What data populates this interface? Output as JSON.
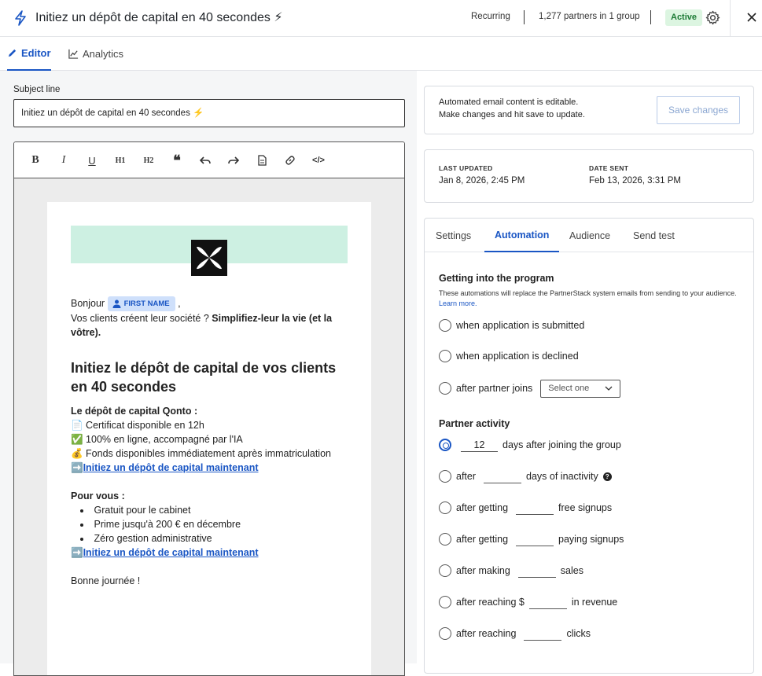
{
  "header": {
    "title": "Initiez un dépôt de capital en 40 secondes ⚡",
    "schedule": "Recurring",
    "audience_summary": "1,277 partners in 1 group",
    "status": "Active",
    "accent": "#1a56c4"
  },
  "tabs": [
    {
      "label": "Editor",
      "icon": "pencil-icon",
      "active": true
    },
    {
      "label": "Analytics",
      "icon": "chart-line-icon",
      "active": false
    }
  ],
  "subject": {
    "label": "Subject line",
    "value": "Initiez un dépôt de capital en 40 secondes ⚡"
  },
  "toolbar": {
    "buttons": [
      "bold-icon",
      "italic-icon",
      "underline-icon",
      "h1-icon",
      "h2-icon",
      "quote-icon",
      "undo-icon",
      "redo-icon",
      "document-icon",
      "link-icon",
      "code-icon"
    ],
    "h1": "H1",
    "h2": "H2"
  },
  "email": {
    "greeting": "Bonjour",
    "merge_tag": "FIRST NAME",
    "greeting_suffix": ",",
    "intro": "Vos clients créent leur société ?",
    "intro_bold": "Simplifiez-leur la vie (et la vôtre).",
    "heading": "Initiez le dépôt de capital de vos clients en 40 secondes",
    "section1_title": "Le dépôt de capital Qonto :",
    "section1_lines": [
      "📄 Certificat disponible en 12h",
      "✅ 100% en ligne, accompagné par l'IA",
      "💰 Fonds disponibles immédiatement après immatriculation"
    ],
    "cta_prefix": "➡️",
    "cta": "Initiez un dépôt de capital maintenant",
    "section2_title": "Pour vous :",
    "section2_items": [
      "Gratuit pour le cabinet",
      "Prime jusqu'à 200 € en décembre",
      "Zéro gestion administrative"
    ],
    "closing": "Bonne journée !"
  },
  "notice": {
    "line1": "Automated email content is editable.",
    "line2": "Make changes and hit save to update.",
    "save_label": "Save changes"
  },
  "dates": {
    "last_updated_label": "LAST UPDATED",
    "last_updated": "Jan 8, 2026, 2:45 PM",
    "date_sent_label": "DATE SENT",
    "date_sent": "Feb 13, 2026, 3:31 PM"
  },
  "panel_tabs": [
    {
      "label": "Settings",
      "active": false
    },
    {
      "label": "Automation",
      "active": true
    },
    {
      "label": "Audience",
      "active": false
    },
    {
      "label": "Send test",
      "active": false
    }
  ],
  "automation": {
    "program_title": "Getting into the program",
    "program_desc": "These automations will replace the PartnerStack system emails from sending to your audience.",
    "learn_more": "Learn more.",
    "program_options": [
      "when application is submitted",
      "when application is declined",
      "after partner joins"
    ],
    "select_placeholder": "Select one",
    "activity_title": "Partner activity",
    "days_value": "12",
    "days_after_label": "days after joining the group",
    "after": "after",
    "inactivity_label": "days of inactivity",
    "after_getting": "after getting",
    "free_signups": "free signups",
    "paying_signups": "paying signups",
    "after_making": "after making",
    "sales": "sales",
    "after_reaching_dollar": "after reaching $",
    "in_revenue": "in revenue",
    "after_reaching": "after reaching",
    "clicks": "clicks"
  }
}
